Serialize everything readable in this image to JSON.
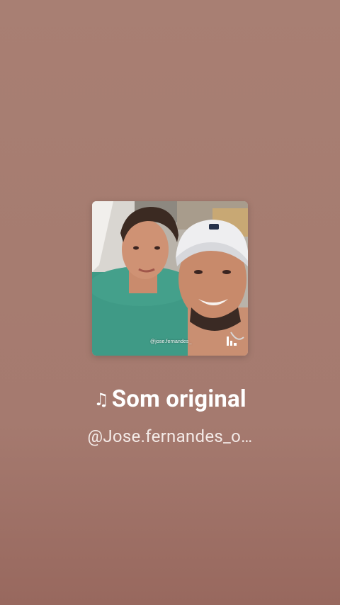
{
  "sound": {
    "title": "Som original",
    "music_icon": "♫",
    "author": "@Jose.fernandes_o…",
    "cover_watermark": "@jose.fernandes_"
  },
  "icons": {
    "music": "music-note-icon",
    "app_logo": "app-logo-icon"
  },
  "colors": {
    "background": "#a67c70",
    "text": "#ffffff"
  }
}
